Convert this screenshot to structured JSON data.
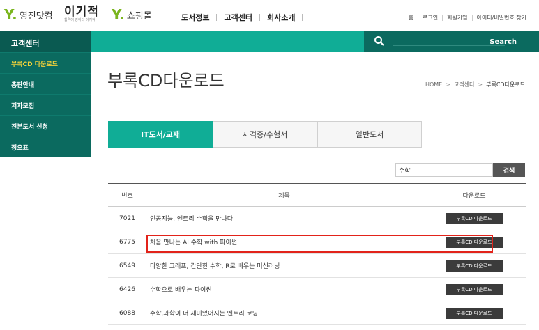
{
  "header": {
    "logos": [
      {
        "mark": "Y.",
        "text": "영진닷컴"
      },
      {
        "big": "이기적",
        "small": "합격에 강하다 이기적"
      },
      {
        "mark": "Y.",
        "text": "쇼핑몰"
      }
    ],
    "nav": [
      "도서정보",
      "고객센터",
      "회사소개"
    ],
    "util": [
      "홈",
      "로그인",
      "회원가입",
      "아이디/비밀번호 찾기"
    ]
  },
  "sidebar": {
    "title": "고객센터",
    "items": [
      {
        "label": "부록CD 다운로드",
        "active": true
      },
      {
        "label": "총판안내"
      },
      {
        "label": "저자모집"
      },
      {
        "label": "견본도서 신청"
      },
      {
        "label": "정오표"
      }
    ]
  },
  "search_bar": {
    "label": "Search"
  },
  "page": {
    "title": "부록CD다운로드",
    "breadcrumb": [
      "HOME",
      "고객센터",
      "부록CD다운로드"
    ]
  },
  "tabs": [
    {
      "label": "IT도서/교재",
      "active": true
    },
    {
      "label": "자격증/수험서"
    },
    {
      "label": "일반도서"
    }
  ],
  "search": {
    "value": "수학",
    "button": "검색"
  },
  "table": {
    "columns": [
      "번호",
      "제목",
      "다운로드"
    ],
    "rows": [
      {
        "num": "7021",
        "title": "인공지능, 엔트리 수학을 만나다",
        "button": "부록CD 다운로드"
      },
      {
        "num": "6775",
        "title": "처음 만나는 AI 수학 with 파이썬",
        "button": "부록CD 다운로드",
        "highlighted": true
      },
      {
        "num": "6549",
        "title": "다양한 그래프, 간단한 수학, R로 배우는 머신러닝",
        "button": "부록CD 다운로드"
      },
      {
        "num": "6426",
        "title": "수학으로 배우는 파이썬",
        "button": "부록CD 다운로드"
      },
      {
        "num": "6088",
        "title": "수학,과학이 더 재미있어지는 엔트리 코딩",
        "button": "부록CD 다운로드"
      }
    ]
  },
  "colors": {
    "teal": "#10ad96",
    "dark_teal": "#0b6a5f",
    "active_menu": "#f3d23a",
    "highlight": "#e2231a"
  }
}
